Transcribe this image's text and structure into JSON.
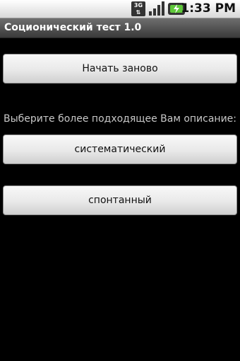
{
  "status_bar": {
    "network_label": "3G",
    "time": "1:33 PM"
  },
  "app": {
    "title": "Соционический тест 1.0"
  },
  "main": {
    "restart_label": "Начать заново",
    "prompt": "Выберите более подходящее Вам описание:",
    "options": [
      {
        "label": "систематический"
      },
      {
        "label": "спонтанный"
      }
    ]
  }
}
